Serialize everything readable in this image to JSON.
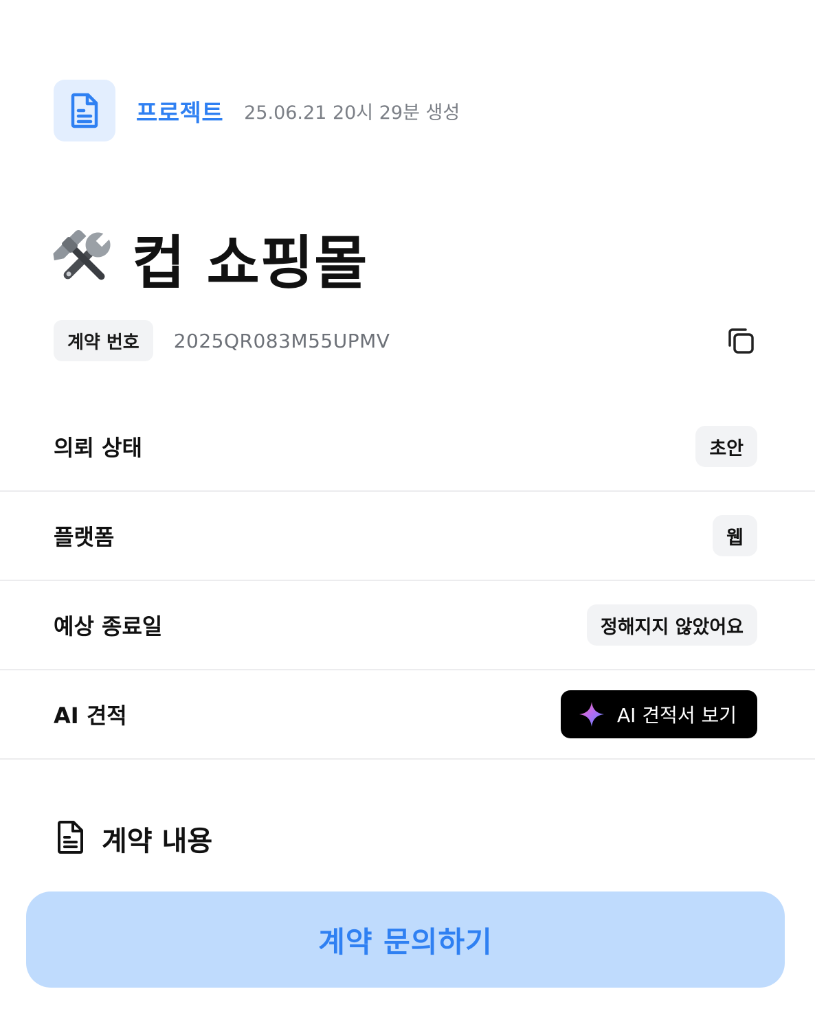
{
  "header": {
    "category": "프로젝트",
    "created": "25.06.21 20시 29분 생성",
    "icon": "document-icon"
  },
  "project": {
    "emoji": "hammer-and-wrench",
    "title": "컵 쇼핑몰"
  },
  "contract": {
    "label": "계약 번호",
    "number": "2025QR083M55UPMV",
    "copy_icon": "copy-icon"
  },
  "info": {
    "status": {
      "label": "의뢰 상태",
      "value": "초안"
    },
    "platform": {
      "label": "플랫폼",
      "value": "웹"
    },
    "due_date": {
      "label": "예상 종료일",
      "value": "정해지지 않았어요"
    },
    "ai_estimate": {
      "label": "AI 견적",
      "button": "AI 견적서 보기",
      "icon": "sparkle-icon"
    }
  },
  "section": {
    "title": "계약 내용",
    "icon": "document-outline-icon"
  },
  "cta": {
    "label": "계약 문의하기"
  },
  "colors": {
    "accent": "#2f80f2",
    "accent_light_bg": "#e3eefe",
    "cta_bg": "#bfdbfd",
    "chip_bg": "#f2f3f5",
    "divider": "#ececee"
  }
}
